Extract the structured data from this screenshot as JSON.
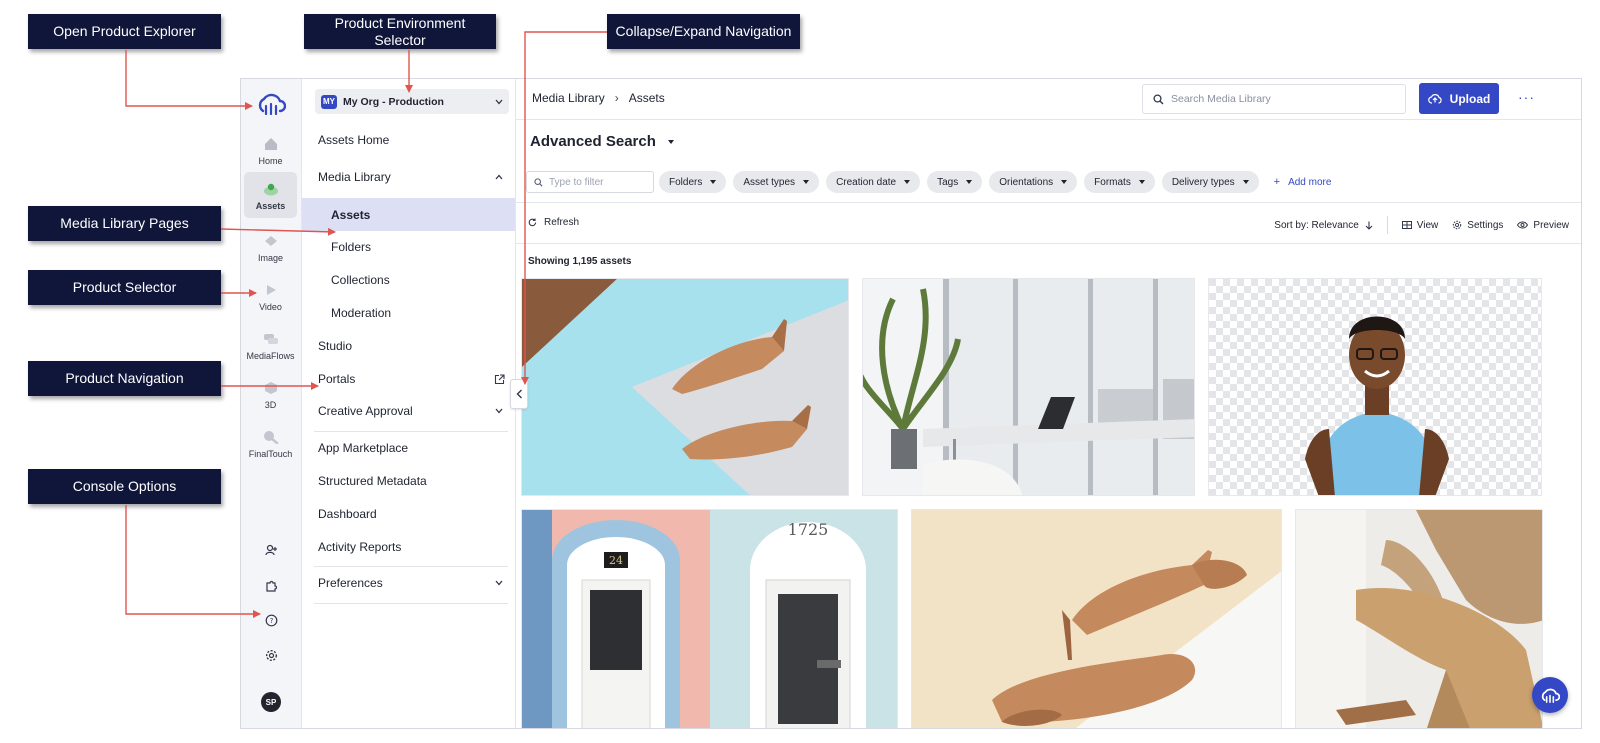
{
  "callouts": {
    "open_product_explorer": "Open Product Explorer",
    "product_environment_selector": "Product Environment Selector",
    "collapse_expand_navigation": "Collapse/Expand Navigation",
    "media_library_pages": "Media Library Pages",
    "product_selector": "Product Selector",
    "product_navigation": "Product Navigation",
    "console_options": "Console Options"
  },
  "rail": {
    "items": [
      {
        "label": "Home",
        "icon": "home-icon"
      },
      {
        "label": "Assets",
        "icon": "assets-icon",
        "active": true
      },
      {
        "label": "Image",
        "icon": "image-icon"
      },
      {
        "label": "Video",
        "icon": "video-icon"
      },
      {
        "label": "MediaFlows",
        "icon": "mediaflows-icon"
      },
      {
        "label": "3D",
        "icon": "3d-icon"
      },
      {
        "label": "FinalTouch",
        "icon": "finaltouch-icon"
      }
    ],
    "utilities": [
      "add-user-icon",
      "puzzle-icon",
      "help-icon",
      "settings-icon"
    ],
    "avatar_initials": "SP"
  },
  "nav": {
    "environment": {
      "badge": "MY",
      "label": "My Org - Production"
    },
    "items": [
      {
        "label": "Assets Home"
      },
      {
        "label": "Media Library",
        "expanded": true
      },
      {
        "label": "Assets",
        "sub": true,
        "selected": true
      },
      {
        "label": "Folders",
        "sub": true
      },
      {
        "label": "Collections",
        "sub": true
      },
      {
        "label": "Moderation",
        "sub": true
      },
      {
        "label": "Studio"
      },
      {
        "label": "Portals",
        "external": true
      },
      {
        "label": "Creative Approval",
        "expandable": true
      },
      {
        "label": "App Marketplace"
      },
      {
        "label": "Structured Metadata"
      },
      {
        "label": "Dashboard"
      },
      {
        "label": "Activity Reports"
      },
      {
        "label": "Preferences",
        "expandable": true
      }
    ]
  },
  "main": {
    "breadcrumb": [
      "Media Library",
      "Assets"
    ],
    "search_placeholder": "Search Media Library",
    "upload_label": "Upload",
    "more_label": "···",
    "title": "Advanced Search",
    "filter_placeholder": "Type to filter",
    "filters": [
      "Folders",
      "Asset types",
      "Creation date",
      "Tags",
      "Orientations",
      "Formats",
      "Delivery types"
    ],
    "add_more": "Add more",
    "refresh": "Refresh",
    "sort_label": "Sort by: Relevance",
    "view_label": "View",
    "settings_label": "Settings",
    "preview_label": "Preview",
    "showing": "Showing 1,195 assets",
    "door_number": "1725",
    "door_number_left": "24"
  },
  "colors": {
    "accent": "#3448c5",
    "callout_bg": "#10163a",
    "arrow": "#e05550",
    "selected_nav": "#dde0f5"
  }
}
